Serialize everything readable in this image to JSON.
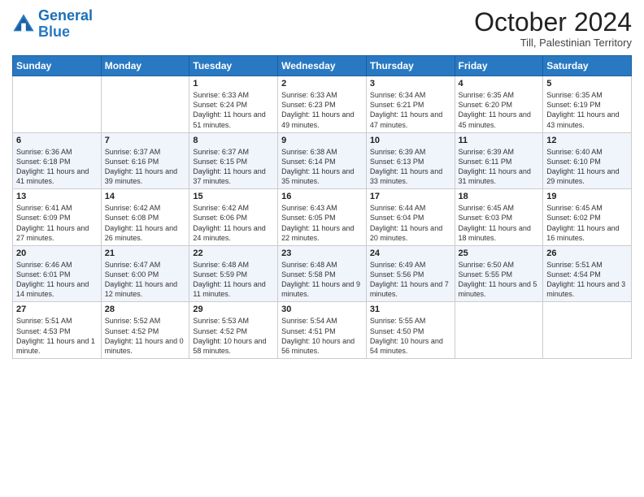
{
  "header": {
    "logo_general": "General",
    "logo_blue": "Blue",
    "month": "October 2024",
    "location": "Till, Palestinian Territory"
  },
  "days_of_week": [
    "Sunday",
    "Monday",
    "Tuesday",
    "Wednesday",
    "Thursday",
    "Friday",
    "Saturday"
  ],
  "weeks": [
    [
      {
        "day": "",
        "info": ""
      },
      {
        "day": "",
        "info": ""
      },
      {
        "day": "1",
        "info": "Sunrise: 6:33 AM\nSunset: 6:24 PM\nDaylight: 11 hours and 51 minutes."
      },
      {
        "day": "2",
        "info": "Sunrise: 6:33 AM\nSunset: 6:23 PM\nDaylight: 11 hours and 49 minutes."
      },
      {
        "day": "3",
        "info": "Sunrise: 6:34 AM\nSunset: 6:21 PM\nDaylight: 11 hours and 47 minutes."
      },
      {
        "day": "4",
        "info": "Sunrise: 6:35 AM\nSunset: 6:20 PM\nDaylight: 11 hours and 45 minutes."
      },
      {
        "day": "5",
        "info": "Sunrise: 6:35 AM\nSunset: 6:19 PM\nDaylight: 11 hours and 43 minutes."
      }
    ],
    [
      {
        "day": "6",
        "info": "Sunrise: 6:36 AM\nSunset: 6:18 PM\nDaylight: 11 hours and 41 minutes."
      },
      {
        "day": "7",
        "info": "Sunrise: 6:37 AM\nSunset: 6:16 PM\nDaylight: 11 hours and 39 minutes."
      },
      {
        "day": "8",
        "info": "Sunrise: 6:37 AM\nSunset: 6:15 PM\nDaylight: 11 hours and 37 minutes."
      },
      {
        "day": "9",
        "info": "Sunrise: 6:38 AM\nSunset: 6:14 PM\nDaylight: 11 hours and 35 minutes."
      },
      {
        "day": "10",
        "info": "Sunrise: 6:39 AM\nSunset: 6:13 PM\nDaylight: 11 hours and 33 minutes."
      },
      {
        "day": "11",
        "info": "Sunrise: 6:39 AM\nSunset: 6:11 PM\nDaylight: 11 hours and 31 minutes."
      },
      {
        "day": "12",
        "info": "Sunrise: 6:40 AM\nSunset: 6:10 PM\nDaylight: 11 hours and 29 minutes."
      }
    ],
    [
      {
        "day": "13",
        "info": "Sunrise: 6:41 AM\nSunset: 6:09 PM\nDaylight: 11 hours and 27 minutes."
      },
      {
        "day": "14",
        "info": "Sunrise: 6:42 AM\nSunset: 6:08 PM\nDaylight: 11 hours and 26 minutes."
      },
      {
        "day": "15",
        "info": "Sunrise: 6:42 AM\nSunset: 6:06 PM\nDaylight: 11 hours and 24 minutes."
      },
      {
        "day": "16",
        "info": "Sunrise: 6:43 AM\nSunset: 6:05 PM\nDaylight: 11 hours and 22 minutes."
      },
      {
        "day": "17",
        "info": "Sunrise: 6:44 AM\nSunset: 6:04 PM\nDaylight: 11 hours and 20 minutes."
      },
      {
        "day": "18",
        "info": "Sunrise: 6:45 AM\nSunset: 6:03 PM\nDaylight: 11 hours and 18 minutes."
      },
      {
        "day": "19",
        "info": "Sunrise: 6:45 AM\nSunset: 6:02 PM\nDaylight: 11 hours and 16 minutes."
      }
    ],
    [
      {
        "day": "20",
        "info": "Sunrise: 6:46 AM\nSunset: 6:01 PM\nDaylight: 11 hours and 14 minutes."
      },
      {
        "day": "21",
        "info": "Sunrise: 6:47 AM\nSunset: 6:00 PM\nDaylight: 11 hours and 12 minutes."
      },
      {
        "day": "22",
        "info": "Sunrise: 6:48 AM\nSunset: 5:59 PM\nDaylight: 11 hours and 11 minutes."
      },
      {
        "day": "23",
        "info": "Sunrise: 6:48 AM\nSunset: 5:58 PM\nDaylight: 11 hours and 9 minutes."
      },
      {
        "day": "24",
        "info": "Sunrise: 6:49 AM\nSunset: 5:56 PM\nDaylight: 11 hours and 7 minutes."
      },
      {
        "day": "25",
        "info": "Sunrise: 6:50 AM\nSunset: 5:55 PM\nDaylight: 11 hours and 5 minutes."
      },
      {
        "day": "26",
        "info": "Sunrise: 5:51 AM\nSunset: 4:54 PM\nDaylight: 11 hours and 3 minutes."
      }
    ],
    [
      {
        "day": "27",
        "info": "Sunrise: 5:51 AM\nSunset: 4:53 PM\nDaylight: 11 hours and 1 minute."
      },
      {
        "day": "28",
        "info": "Sunrise: 5:52 AM\nSunset: 4:52 PM\nDaylight: 11 hours and 0 minutes."
      },
      {
        "day": "29",
        "info": "Sunrise: 5:53 AM\nSunset: 4:52 PM\nDaylight: 10 hours and 58 minutes."
      },
      {
        "day": "30",
        "info": "Sunrise: 5:54 AM\nSunset: 4:51 PM\nDaylight: 10 hours and 56 minutes."
      },
      {
        "day": "31",
        "info": "Sunrise: 5:55 AM\nSunset: 4:50 PM\nDaylight: 10 hours and 54 minutes."
      },
      {
        "day": "",
        "info": ""
      },
      {
        "day": "",
        "info": ""
      }
    ]
  ]
}
